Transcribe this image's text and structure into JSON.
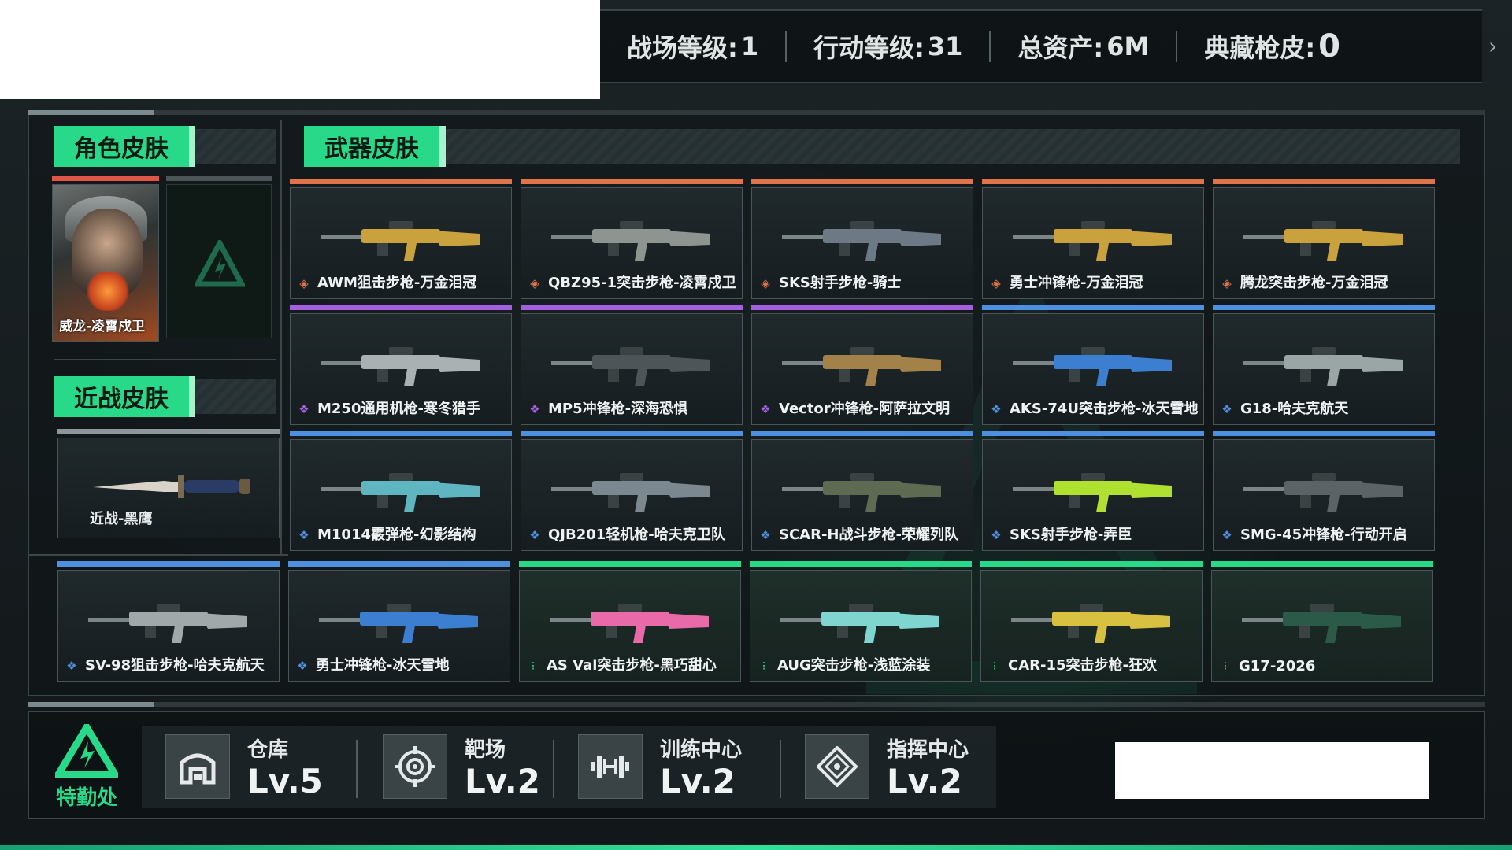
{
  "header": {
    "stats": [
      {
        "label": "战场等级:",
        "value": "1"
      },
      {
        "label": "行动等级: ",
        "value": "31"
      },
      {
        "label": "总资产:",
        "value": "6M"
      },
      {
        "label": "典藏枪皮:",
        "value": "0"
      }
    ],
    "next_icon": "chevron-right-icon"
  },
  "sections": {
    "character": "角色皮肤",
    "melee": "近战皮肤",
    "weapon": "武器皮肤"
  },
  "character_skin": {
    "name": "威龙-凌霄戍卫",
    "rarity_color": "#e05548"
  },
  "melee_skin": {
    "name": "近战-黑鹰"
  },
  "rarity_colors": {
    "red": "#e0734a",
    "purple": "#a45ee0",
    "blue": "#4f8fe0",
    "green": "#27d989"
  },
  "weapon_skins": [
    {
      "name": "AWM狙击步枪-万金泪冠",
      "rarity": "red",
      "gun_color": "#c9a23e"
    },
    {
      "name": "QBZ95-1突击步枪-凌霄戍卫",
      "rarity": "red",
      "gun_color": "#8e9590"
    },
    {
      "name": "SKS射手步枪-骑士",
      "rarity": "red",
      "gun_color": "#6d7a86"
    },
    {
      "name": "勇士冲锋枪-万金泪冠",
      "rarity": "red",
      "gun_color": "#c9a23e"
    },
    {
      "name": "腾龙突击步枪-万金泪冠",
      "rarity": "red",
      "gun_color": "#c9a23e"
    },
    {
      "name": "M250通用机枪-寒冬猎手",
      "rarity": "purple",
      "gun_color": "#a9b1b3"
    },
    {
      "name": "MP5冲锋枪-深海恐惧",
      "rarity": "purple",
      "gun_color": "#4d5558"
    },
    {
      "name": "Vector冲锋枪-阿萨拉文明",
      "rarity": "purple",
      "gun_color": "#a3824a"
    },
    {
      "name": "AKS-74U突击步枪-冰天雪地",
      "rarity": "blue",
      "gun_color": "#3c7fd0"
    },
    {
      "name": "G18-哈夫克航天",
      "rarity": "blue",
      "gun_color": "#9aa5a6"
    },
    {
      "name": "M1014霰弹枪-幻影结构",
      "rarity": "blue",
      "gun_color": "#5fb6c0"
    },
    {
      "name": "QJB201轻机枪-哈夫克卫队",
      "rarity": "blue",
      "gun_color": "#7b8890"
    },
    {
      "name": "SCAR-H战斗步枪-荣耀列队",
      "rarity": "blue",
      "gun_color": "#5e6a52"
    },
    {
      "name": "SKS射手步枪-弄臣",
      "rarity": "blue",
      "gun_color": "#b0e030"
    },
    {
      "name": "SMG-45冲锋枪-行动开启",
      "rarity": "blue",
      "gun_color": "#5b6366"
    },
    {
      "name": "SV-98狙击步枪-哈夫克航天",
      "rarity": "blue",
      "gun_color": "#a0a8aa"
    },
    {
      "name": "勇士冲锋枪-冰天雪地",
      "rarity": "blue",
      "gun_color": "#3c7fd0"
    },
    {
      "name": "AS Val突击步枪-黑巧甜心",
      "rarity": "green",
      "gun_color": "#e86aa8"
    },
    {
      "name": "AUG突击步枪-浅蓝涂装",
      "rarity": "green",
      "gun_color": "#7fd6d0"
    },
    {
      "name": "CAR-15突击步枪-狂欢",
      "rarity": "green",
      "gun_color": "#d8c040"
    },
    {
      "name": "G17-2026",
      "rarity": "green",
      "gun_color": "#2b5a48"
    }
  ],
  "footer": {
    "logo_text": "特勤处",
    "facilities": [
      {
        "name": "仓库",
        "level": "Lv.5",
        "icon": "storage-icon"
      },
      {
        "name": "靶场",
        "level": "Lv.2",
        "icon": "target-icon"
      },
      {
        "name": "训练中心",
        "level": "Lv.2",
        "icon": "dumbbell-icon"
      },
      {
        "name": "指挥中心",
        "level": "Lv.2",
        "icon": "command-icon"
      }
    ]
  }
}
